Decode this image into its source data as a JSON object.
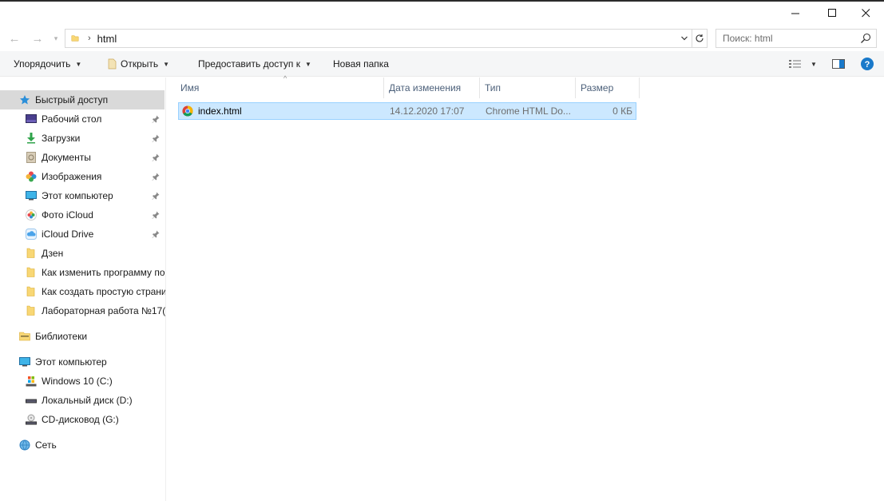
{
  "window": {
    "controls": {
      "minimize": "minimize",
      "maximize": "maximize",
      "close": "close"
    }
  },
  "address": {
    "path": "html",
    "search_placeholder": "Поиск: html"
  },
  "toolbar": {
    "organize": "Упорядочить",
    "open": "Открыть",
    "share": "Предоставить доступ к",
    "new_folder": "Новая папка"
  },
  "nav": {
    "quick_access": "Быстрый доступ",
    "quick_items": [
      {
        "label": "Рабочий стол",
        "icon": "desktop-icon",
        "pinned": true
      },
      {
        "label": "Загрузки",
        "icon": "downloads-icon",
        "pinned": true
      },
      {
        "label": "Документы",
        "icon": "documents-icon",
        "pinned": true
      },
      {
        "label": "Изображения",
        "icon": "pictures-icon",
        "pinned": true
      },
      {
        "label": "Этот компьютер",
        "icon": "computer-icon",
        "pinned": true
      },
      {
        "label": "Фото iCloud",
        "icon": "icloud-photos-icon",
        "pinned": true
      },
      {
        "label": "iCloud Drive",
        "icon": "icloud-drive-icon",
        "pinned": true
      },
      {
        "label": "Дзен",
        "icon": "folder-icon",
        "pinned": false
      },
      {
        "label": "Как изменить программу по",
        "icon": "folder-icon",
        "pinned": false
      },
      {
        "label": "Как создать простую страни",
        "icon": "folder-icon",
        "pinned": false
      },
      {
        "label": "Лабораторная работа №17(",
        "icon": "folder-icon",
        "pinned": false
      }
    ],
    "libraries": "Библиотеки",
    "this_pc": "Этот компьютер",
    "drives": [
      {
        "label": "Windows 10 (C:)",
        "icon": "windows-drive-icon"
      },
      {
        "label": "Локальный диск (D:)",
        "icon": "drive-icon"
      },
      {
        "label": "CD-дисковод (G:)",
        "icon": "cd-drive-icon"
      }
    ],
    "network": "Сеть"
  },
  "files": {
    "columns": {
      "name": "Имя",
      "date": "Дата изменения",
      "type": "Тип",
      "size": "Размер"
    },
    "rows": [
      {
        "name": "index.html",
        "date": "14.12.2020 17:07",
        "type": "Chrome HTML Do...",
        "size": "0 КБ",
        "icon": "chrome-icon"
      }
    ]
  },
  "colors": {
    "selection_bg": "#cce8ff",
    "selection_border": "#99d1ff",
    "nav_selected": "#d9d9d9",
    "header_text": "#4c607a",
    "folder": "#f8d775",
    "accent": "#1979ca"
  }
}
